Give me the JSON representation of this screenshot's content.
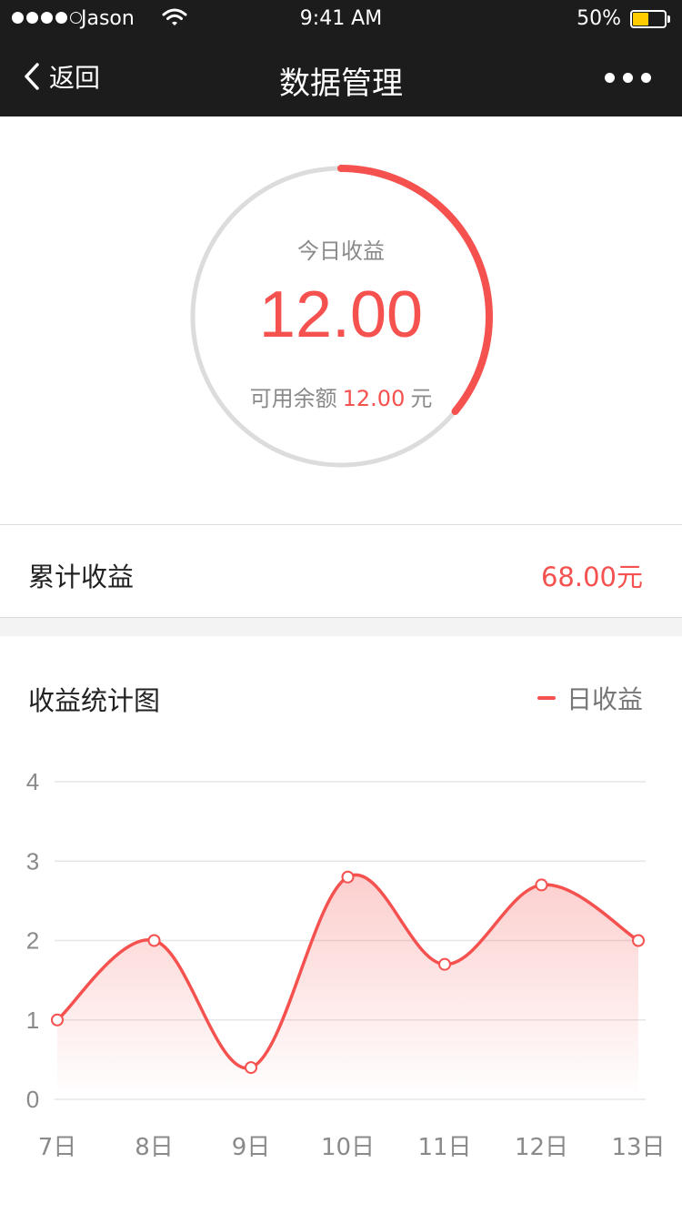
{
  "status_bar": {
    "carrier": "Jason",
    "time": "9:41 AM",
    "battery": "50%",
    "battery_level": 0.5
  },
  "nav": {
    "back_label": "返回",
    "title": "数据管理"
  },
  "today": {
    "label": "今日收益",
    "value": "12.00",
    "balance_prefix": "可用余额",
    "balance_value": "12.00",
    "balance_unit": "元",
    "progress": 0.36,
    "colors": {
      "accent": "#f4514f",
      "track": "#dcdcdc"
    }
  },
  "total": {
    "label": "累计收益",
    "value": "68.00元"
  },
  "chart_section": {
    "title": "收益统计图",
    "legend": "日收益"
  },
  "chart_data": {
    "type": "area",
    "categories": [
      "7日",
      "8日",
      "9日",
      "10日",
      "11日",
      "12日",
      "13日"
    ],
    "series": [
      {
        "name": "日收益",
        "values": [
          1.0,
          2.0,
          0.4,
          2.8,
          1.7,
          2.7,
          2.0
        ],
        "color": "#f4514f"
      }
    ],
    "y_ticks": [
      0,
      1,
      2,
      3,
      4
    ],
    "ylim": [
      0,
      4
    ],
    "grid": true,
    "smooth": true,
    "legend_position": "top-right"
  }
}
